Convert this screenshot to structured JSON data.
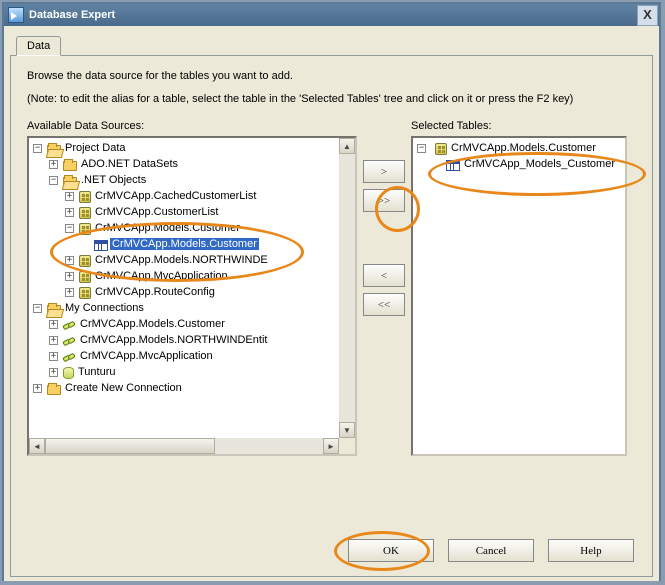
{
  "window": {
    "title": "Database Expert",
    "close_label": "X"
  },
  "tab": {
    "data": "Data"
  },
  "intro": "Browse the data source for the tables you want to add.",
  "note": "(Note: to edit the alias for a table, select the table in the 'Selected Tables' tree and click on it or press the F2 key)",
  "labels": {
    "available": "Available Data Sources:",
    "selected": "Selected Tables:"
  },
  "transfer": {
    "add": ">",
    "add_all": ">>",
    "remove": "<",
    "remove_all": "<<"
  },
  "tree_left": {
    "project_data": "Project Data",
    "ado_net": "ADO.NET DataSets",
    "net_objects": ".NET Objects",
    "items": [
      "CrMVCApp.CachedCustomerList",
      "CrMVCApp.CustomerList",
      "CrMVCApp.Models.Customer",
      "CrMVCApp.Models.NORTHWINDE",
      "CrMVCApp.MvcApplication",
      "CrMVCApp.RouteConfig"
    ],
    "selected_table": "CrMVCApp.Models.Customer",
    "my_connections": "My Connections",
    "my_conn_items": [
      "CrMVCApp.Models.Customer",
      "CrMVCApp.Models.NORTHWINDEntit",
      "CrMVCApp.MvcApplication",
      "Tunturu"
    ],
    "create_new": "Create New Connection"
  },
  "tree_right": {
    "root": "CrMVCApp.Models.Customer",
    "table": "CrMVCApp_Models_Customer"
  },
  "buttons": {
    "ok": "OK",
    "cancel": "Cancel",
    "help": "Help"
  }
}
